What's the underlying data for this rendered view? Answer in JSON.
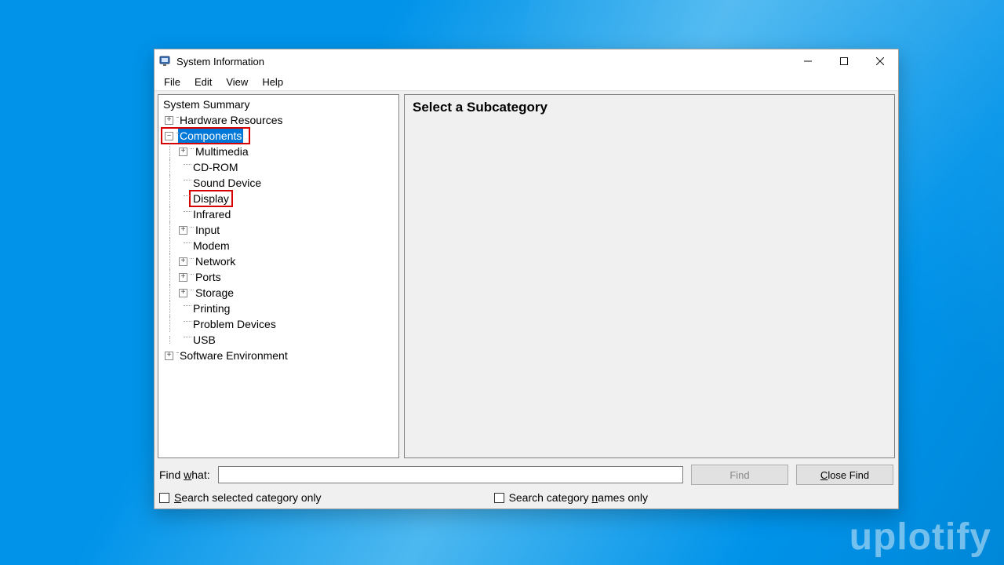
{
  "window": {
    "title": "System Information",
    "menu": [
      "File",
      "Edit",
      "View",
      "Help"
    ]
  },
  "tree": {
    "root": "System Summary",
    "hardware_resources": "Hardware Resources",
    "components": "Components",
    "multimedia": "Multimedia",
    "cdrom": "CD-ROM",
    "sound_device": "Sound Device",
    "display": "Display",
    "infrared": "Infrared",
    "input": "Input",
    "modem": "Modem",
    "network": "Network",
    "ports": "Ports",
    "storage": "Storage",
    "printing": "Printing",
    "problem_devices": "Problem Devices",
    "usb": "USB",
    "software_environment": "Software Environment"
  },
  "content": {
    "heading": "Select a Subcategory"
  },
  "find": {
    "label": "Find what:",
    "value": "",
    "find_button": "Find",
    "close_button": "Close Find",
    "search_selected": "Search selected category only",
    "search_names": "Search category names only"
  },
  "watermark": "uplotify"
}
